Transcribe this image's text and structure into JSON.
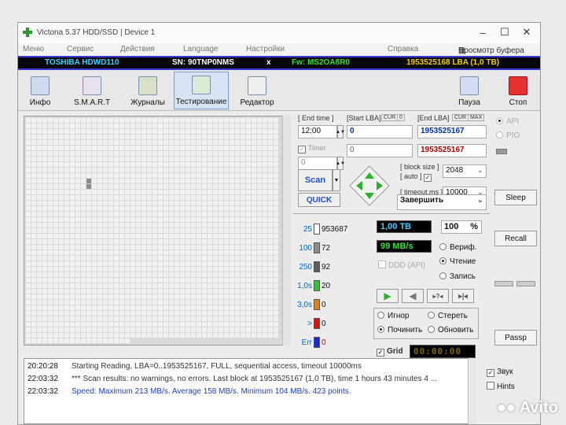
{
  "window": {
    "title": "Victona 5.37 HDD/SSD | Device 1",
    "minimize_label": "–",
    "maximize_label": "☐",
    "close_label": "✕"
  },
  "menu": {
    "items": [
      "Меню",
      "Сервис",
      "Действия",
      "Language",
      "Настройки",
      "Справка"
    ],
    "buffer_view": "Просмотр буфера"
  },
  "infobar": {
    "model": "TOSHIBA HDWD110",
    "serial": "SN: 90TNP0NMS",
    "close_x": "x",
    "firmware": "Fw: MS2OA8R0",
    "capacity": "1953525168 LBA (1,0 TB)"
  },
  "toolbar": {
    "info": "Инфо",
    "smart": "S.M.A.R.T",
    "journals": "Журналы",
    "testing": "Тестирование",
    "editor": "Редактор",
    "pause": "Пауза",
    "stop": "Стоп"
  },
  "params": {
    "end_time_label": "[ End time ]",
    "end_time_value": "12:00",
    "timer_label": "Timer",
    "timer_value": "0",
    "start_lba_label": "[Start LBA]",
    "start_lba_value": "0",
    "start_lba_field2": "0",
    "cur_label": "CUR",
    "cur_value": "0",
    "end_lba_label": "[End LBA]",
    "end_lba_cur": "CUR",
    "end_lba_max": "MAX",
    "end_lba_value": "1953525167",
    "end_lba_value2": "1953525167",
    "block_size_label": "[ block size ]",
    "auto_label": "[ auto ]",
    "block_size_value": "2048",
    "timeout_label": "[ timeout.ms ]",
    "timeout_value": "10000",
    "scan_button": "Scan",
    "quick_button": "QUICK",
    "finish_action": "Завершить"
  },
  "legend": [
    {
      "label": "25",
      "count": "953687",
      "color": "#ffffff"
    },
    {
      "label": "100",
      "count": "72",
      "color": "#8c8c8c"
    },
    {
      "label": "250",
      "count": "92",
      "color": "#5c5c5c"
    },
    {
      "label": "1,0s",
      "count": "20",
      "color": "#36c236"
    },
    {
      "label": "3,0s",
      "count": "0",
      "color": "#e0801a"
    },
    {
      "label": ">",
      "count": "0",
      "color": "#dd1111"
    },
    {
      "label": "Err",
      "count": "0",
      "color": "#1a2bd6"
    }
  ],
  "status": {
    "capacity": "1,00 TB",
    "percent": "100",
    "percent_unit": "%",
    "speed": "99 MB/s",
    "ddd_api": "DDD (API)",
    "verify": "Вериф.",
    "read": "Чтение",
    "write": "Запись",
    "ignore": "Игнор",
    "erase": "Стереть",
    "repair": "Починить",
    "refresh": "Обновить",
    "grid_label": "Grid",
    "elapsed": "00:00:00"
  },
  "side": {
    "api": "API",
    "pio": "PIO",
    "sleep": "Sleep",
    "recall": "Recall",
    "passp": "Passp",
    "sound": "Звук",
    "hints": "Hints"
  },
  "log": [
    {
      "time": "20:20:28",
      "text": "Starting Reading, LBA=0..1953525167, FULL, sequential access, timeout 10000ms",
      "color": "#333333"
    },
    {
      "time": "22:03:32",
      "text": "*** Scan results: no warnings, no errors. Last block at 1953525167 (1,0 TB), time 1 hours 43 minutes 4 ...",
      "color": "#333333"
    },
    {
      "time": "22:03:32",
      "text": "Speed: Maximum 213 MB/s. Average 158 MB/s. Minimum 104 MB/s. 423 points.",
      "color": "#1f3fbf"
    }
  ],
  "watermark": "Avito"
}
